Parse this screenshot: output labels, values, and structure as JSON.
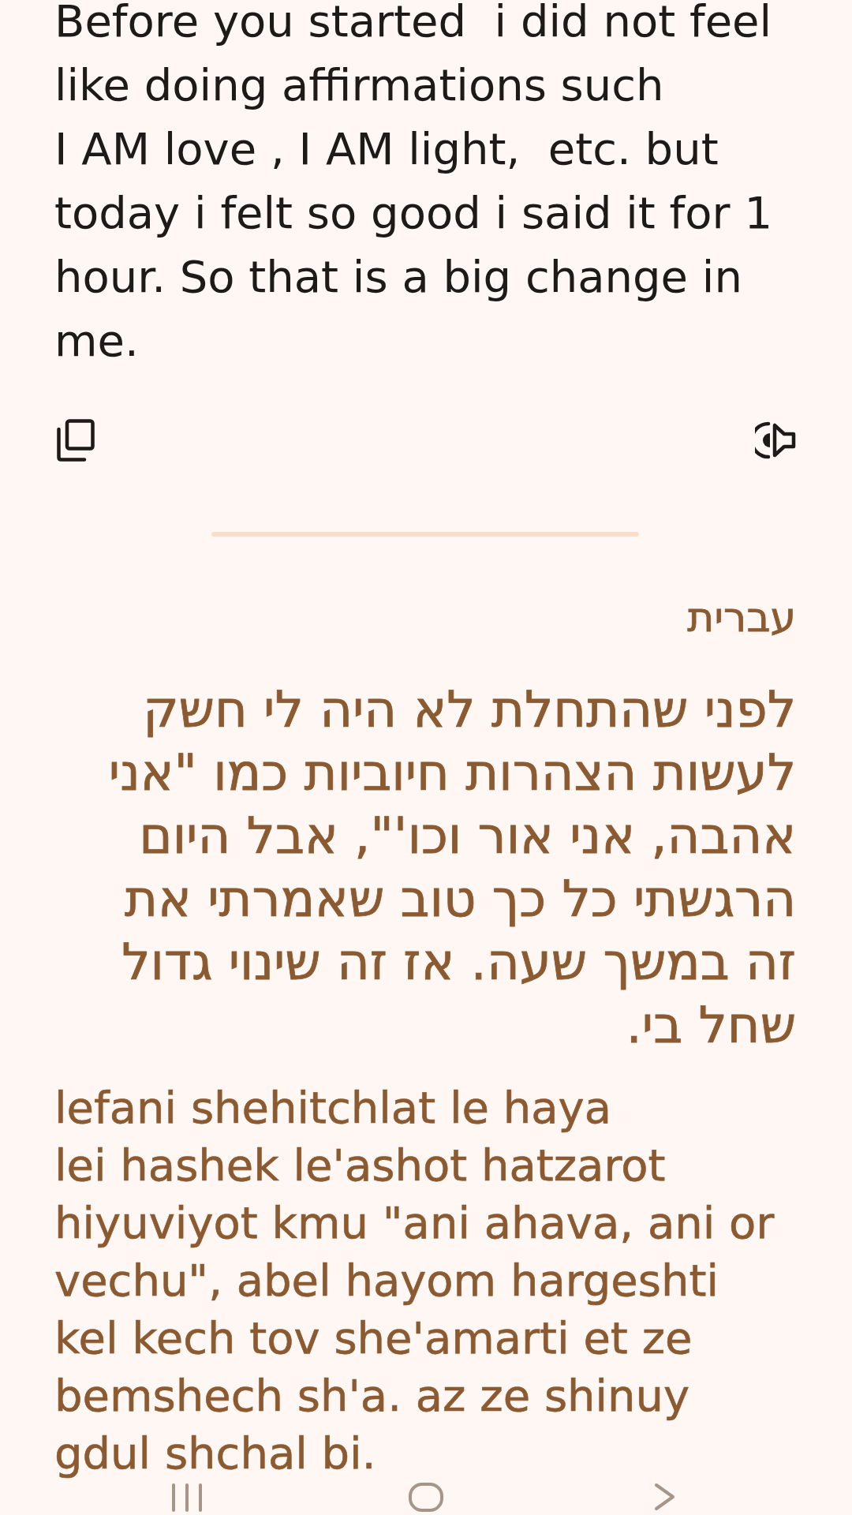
{
  "source": {
    "text": "Before you started  i did not feel like doing affirmations such\nI AM love , I AM light,  etc. but today i felt so good i said it for 1 hour. So that is a big change in me."
  },
  "translation": {
    "language": "עברית",
    "text": "לפני שהתחלת לא היה לי חשק לעשות הצהרות חיוביות כמו \"אני אהבה, אני אור וכו'\", אבל היום הרגשתי כל כך טוב שאמרתי את זה במשך שעה. אז זה שינוי גדול שחל בי.",
    "transliteration": "lefani shehitchlat le haya\nlei hashek le'ashot hatzarot hiyuviyot kmu \"ani ahava, ani or vechu\", abel hayom hargeshti kel kech tov she'amarti et ze bemshech sh'a. az ze shinuy gdul shchal bi."
  }
}
